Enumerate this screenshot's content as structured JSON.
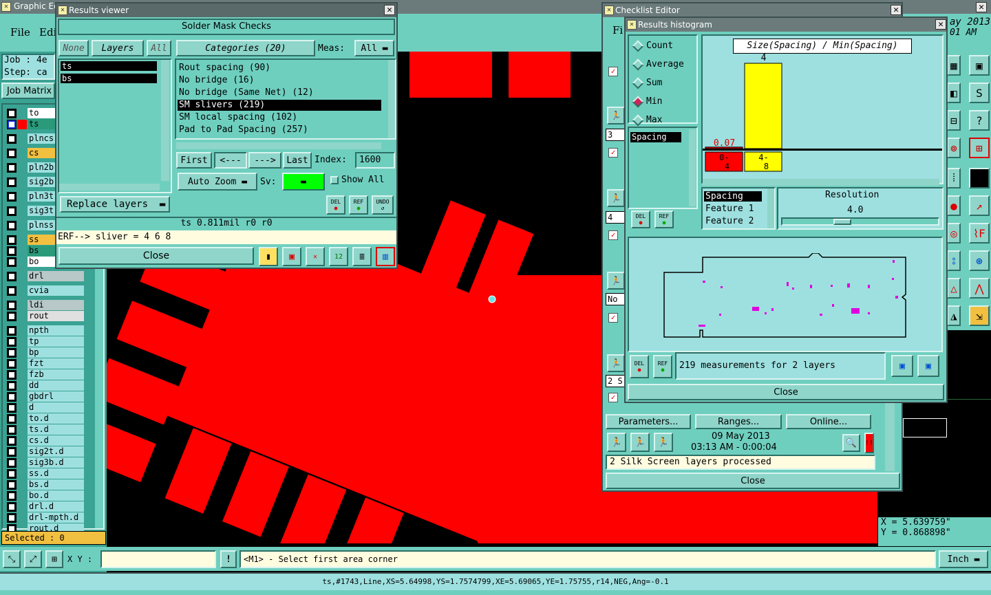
{
  "main": {
    "title": "Graphic Editor",
    "menu": [
      "File",
      "Edit"
    ],
    "job_label": "Job : 4e",
    "step_label": "Step: ca",
    "job_matrix_button": "Job Matrix",
    "datetime_partial": [
      "ay 2013",
      "01 AM"
    ],
    "selected_label": "Selected : 0",
    "xy_label": "X Y :",
    "xy_value": "",
    "prompt": "<M1> - Select first area corner",
    "units": "Inch",
    "status_line": "ts,#1743,Line,XS=5.64998,YS=1.7574799,XE=5.69065,YE=1.75755,r14,NEG,Ang=-0.1",
    "coord_x": "X  =  5.639759\"",
    "coord_y": "Y  =  0.868898\""
  },
  "layers": [
    {
      "name": "to",
      "color": "#ffffff"
    },
    {
      "name": "ts",
      "color": "#2a9a7a",
      "active": true
    },
    {
      "name": "plncs",
      "color": "#9ee0e0"
    },
    {
      "name": "cs",
      "color": "#f2c040"
    },
    {
      "name": "pln2b",
      "color": "#9ee0e0"
    },
    {
      "name": "sig2b",
      "color": "#9ee0e0"
    },
    {
      "name": "pln3t",
      "color": "#9ee0e0"
    },
    {
      "name": "sig3t",
      "color": "#9ee0e0"
    },
    {
      "name": "plnss",
      "color": "#9ee0e0"
    },
    {
      "name": "ss",
      "color": "#f2c040"
    },
    {
      "name": "bs",
      "color": "#2a9a7a"
    },
    {
      "name": "bo",
      "color": "#ffffff"
    },
    {
      "name": "drl",
      "color": "#b8c8c8"
    },
    {
      "name": "cvia",
      "color": "#9ee0e0"
    },
    {
      "name": "ldi",
      "color": "#b8c8c8"
    },
    {
      "name": "rout",
      "color": "#e0e0e0"
    },
    {
      "name": "npth",
      "color": "#9ee0e0"
    },
    {
      "name": "tp",
      "color": "#9ee0e0"
    },
    {
      "name": "bp",
      "color": "#9ee0e0"
    },
    {
      "name": "fzt",
      "color": "#9ee0e0"
    },
    {
      "name": "fzb",
      "color": "#9ee0e0"
    },
    {
      "name": "dd",
      "color": "#9ee0e0"
    },
    {
      "name": "gbdrl",
      "color": "#9ee0e0"
    },
    {
      "name": "d",
      "color": "#9ee0e0"
    },
    {
      "name": "to.d",
      "color": "#9ee0e0"
    },
    {
      "name": "ts.d",
      "color": "#9ee0e0"
    },
    {
      "name": "cs.d",
      "color": "#9ee0e0"
    },
    {
      "name": "sig2t.d",
      "color": "#9ee0e0"
    },
    {
      "name": "sig3b.d",
      "color": "#9ee0e0"
    },
    {
      "name": "ss.d",
      "color": "#9ee0e0"
    },
    {
      "name": "bs.d",
      "color": "#9ee0e0"
    },
    {
      "name": "bo.d",
      "color": "#9ee0e0"
    },
    {
      "name": "drl.d",
      "color": "#9ee0e0"
    },
    {
      "name": "drl-mpth.d",
      "color": "#9ee0e0"
    },
    {
      "name": "rout.d",
      "color": "#9ee0e0"
    }
  ],
  "results_viewer": {
    "title": "Results viewer",
    "header": "Solder Mask Checks",
    "none_btn": "None",
    "layers_btn": "Layers",
    "all_btn": "All",
    "categories_btn": "Categories (20)",
    "meas_label": "Meas:",
    "meas_value": "All",
    "layer_items": [
      "ts",
      "bs"
    ],
    "categories": [
      "Rout spacing (90)",
      "No bridge (16)",
      "No bridge (Same Net) (12)",
      "SM slivers (219)",
      "SM local spacing (102)",
      "Pad to Pad Spacing (257)"
    ],
    "selected_category": 3,
    "first_btn": "First",
    "prev_btn": "<---",
    "next_btn": "--->",
    "last_btn": "Last",
    "index_label": "Index:",
    "index_value": "1600",
    "auto_zoom": "Auto Zoom",
    "sv_label": "Sv:",
    "show_all": "Show All",
    "replace_layers": "Replace layers",
    "del": "DEL",
    "ref": "REF",
    "undo": "UNDO",
    "measure_line": "ts 0.811mil  r0  r0",
    "erf_line": "ERF--> sliver = 4 6 8",
    "close": "Close"
  },
  "checklist_editor": {
    "title": "Checklist Editor",
    "menu_partial": "Fi",
    "rows_partial": [
      "3",
      "4",
      "No",
      "2 S"
    ],
    "parameters_btn": "Parameters...",
    "ranges_btn": "Ranges...",
    "online_btn": "Online...",
    "date": "09 May 2013",
    "time": "03:13 AM - 0:00:04",
    "status": "2 Silk Screen layers processed",
    "close": "Close"
  },
  "histogram": {
    "title": "Results histogram",
    "modes": [
      "Count",
      "Average",
      "Sum",
      "Min",
      "Max"
    ],
    "selected_mode": 3,
    "chart_title": "Size(Spacing) / Min(Spacing)",
    "list_item": "Spacing",
    "bars": [
      {
        "label": "0-\n4",
        "value": 0.07,
        "value_text": "0.07",
        "color": "#ff0000"
      },
      {
        "label": "4-\n8",
        "value": 4,
        "value_text": "4",
        "color": "#ffff00"
      }
    ],
    "fields": [
      "Spacing",
      "Feature 1",
      "Feature 2"
    ],
    "resolution_label": "Resolution",
    "resolution_value": "4.0",
    "measurements": "219 measurements for 2 layers",
    "del": "DEL",
    "ref": "REF",
    "close": "Close"
  },
  "chart_data": {
    "type": "bar",
    "categories": [
      "0-4",
      "4-8"
    ],
    "values": [
      0.07,
      4
    ],
    "title": "Size(Spacing) / Min(Spacing)",
    "ylim": [
      0,
      4
    ]
  }
}
